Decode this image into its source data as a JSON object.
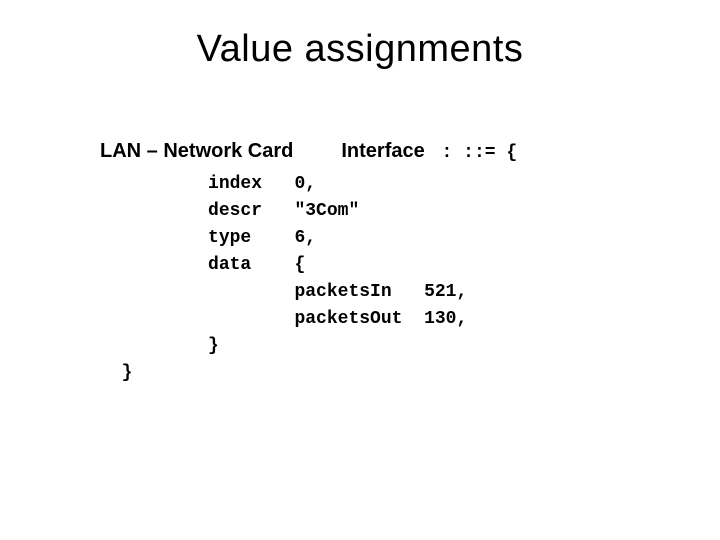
{
  "title": "Value assignments",
  "line1": {
    "lan": "LAN – Network Card",
    "iface": "Interface",
    "tail": " : ::= {"
  },
  "rows": {
    "r1_key": "index",
    "r1_val": "0,",
    "r2_key": "descr",
    "r2_val": "\"3Com\"",
    "r3_key": "type",
    "r3_val": "6,",
    "r4_key": "data",
    "r4_val": "{",
    "r5_key": "packetsIn",
    "r5_val": "521,",
    "r6_key": "packetsOut",
    "r6_val": "130,",
    "close_inner": "}",
    "close_outer": "}"
  }
}
